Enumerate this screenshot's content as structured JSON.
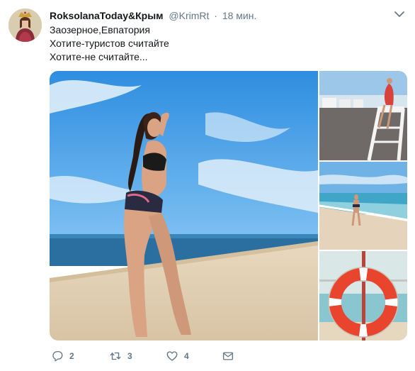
{
  "tweet": {
    "author_name": "RoksolanaToday&Крым",
    "handle": "@KrimRt",
    "separator": "·",
    "time": "18 мин.",
    "lines": [
      "Заозерное,Евпатория",
      "Хотите-туристов считайте",
      "Хотите-не считайте..."
    ]
  },
  "actions": {
    "reply_count": "2",
    "retweet_count": "3",
    "like_count": "4"
  },
  "icons": {
    "menu": "chevron-down-icon",
    "reply": "reply-icon",
    "retweet": "retweet-icon",
    "like": "heart-icon",
    "dm": "envelope-icon"
  },
  "colors": {
    "icon_gray": "#657786",
    "text": "#14171a"
  }
}
